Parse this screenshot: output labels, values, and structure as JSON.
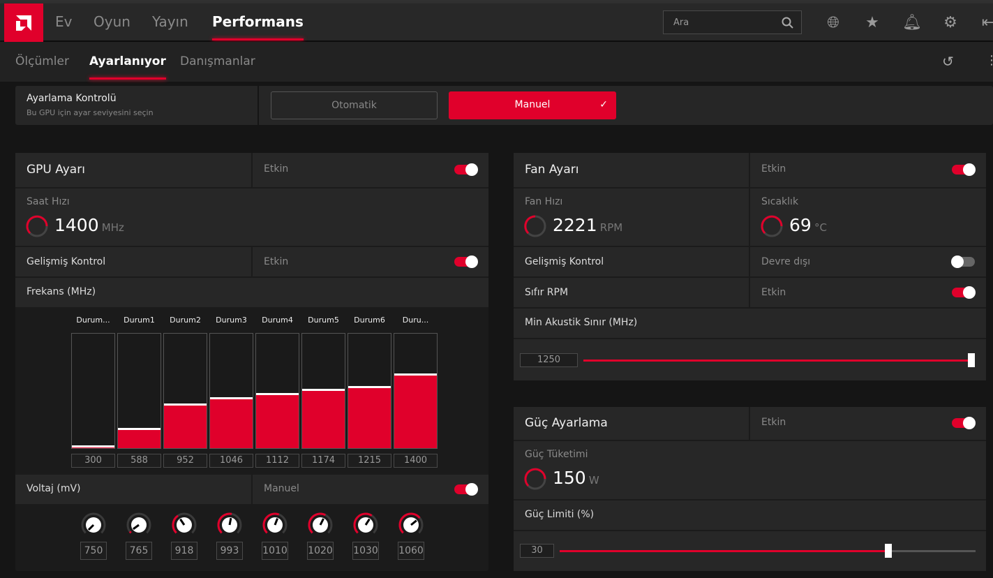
{
  "nav": {
    "tabs": [
      "Ev",
      "Oyun",
      "Yayın",
      "Performans"
    ],
    "active": "Performans",
    "search_placeholder": "Ara"
  },
  "subnav": {
    "tabs": [
      "Ölçümler",
      "Ayarlanıyor",
      "Danışmanlar"
    ],
    "active": "Ayarlanıyor"
  },
  "control": {
    "title": "Ayarlama Kontrolü",
    "subtitle": "Bu GPU için ayar seviyesini seçin",
    "auto_label": "Otomatik",
    "manual_label": "Manuel",
    "selected": "Manuel"
  },
  "gpu": {
    "title": "GPU Ayarı",
    "status": "Etkin",
    "enabled": true,
    "clock_label": "Saat Hızı",
    "clock_value": "1400",
    "clock_unit": "MHz",
    "advanced_label": "Gelişmiş Kontrol",
    "advanced_status": "Etkin",
    "advanced_enabled": true,
    "freq_label": "Frekans (MHz)",
    "states": [
      {
        "label": "Durum...",
        "freq": 300
      },
      {
        "label": "Durum1",
        "freq": 588
      },
      {
        "label": "Durum2",
        "freq": 952
      },
      {
        "label": "Durum3",
        "freq": 1046
      },
      {
        "label": "Durum4",
        "freq": 1112
      },
      {
        "label": "Durum5",
        "freq": 1174
      },
      {
        "label": "Durum6",
        "freq": 1215
      },
      {
        "label": "Duru...",
        "freq": 1400
      }
    ],
    "freq_range": [
      280,
      2000
    ],
    "voltage_label": "Voltaj (mV)",
    "voltage_status": "Manuel",
    "voltage_enabled": true,
    "voltages": [
      750,
      765,
      918,
      993,
      1010,
      1020,
      1030,
      1060
    ],
    "voltage_range": [
      750,
      1200
    ]
  },
  "fan": {
    "title": "Fan Ayarı",
    "status": "Etkin",
    "enabled": true,
    "speed_label": "Fan Hızı",
    "speed_value": "2221",
    "speed_unit": "RPM",
    "temp_label": "Sıcaklık",
    "temp_value": "69",
    "temp_unit": "°C",
    "advanced_label": "Gelişmiş Kontrol",
    "advanced_status": "Devre dışı",
    "advanced_enabled": false,
    "zero_rpm_label": "Sıfır RPM",
    "zero_rpm_status": "Etkin",
    "zero_rpm_enabled": true,
    "acoustic_label": "Min Akustik Sınır (MHz)",
    "acoustic_value": "1250",
    "acoustic_fraction": 1.0
  },
  "power": {
    "title": "Güç Ayarlama",
    "status": "Etkin",
    "enabled": true,
    "consumption_label": "Güç Tüketimi",
    "consumption_value": "150",
    "consumption_unit": "W",
    "limit_label": "Güç Limiti (%)",
    "limit_value": "30",
    "limit_fraction": 0.79
  },
  "colors": {
    "accent": "#e0002b"
  }
}
